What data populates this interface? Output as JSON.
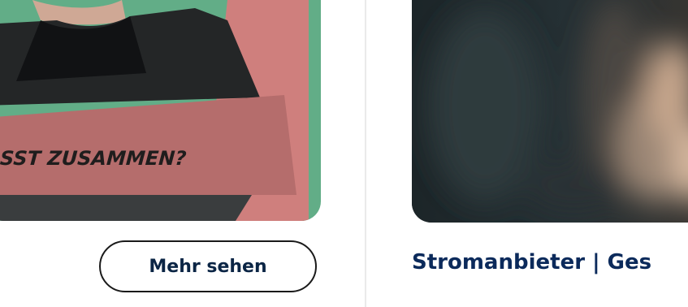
{
  "left_card": {
    "banner_text": "SST ZUSAMMEN?",
    "colors": {
      "background_green": "#62ad87",
      "banner_pink": "#cf7f7d",
      "banner_dark_pink": "#b26b6a",
      "jacket": "#222425",
      "skin": "#d9b8a3"
    }
  },
  "more_button": {
    "label": "Mehr sehen"
  },
  "right_card": {
    "title": "Stromanbieter | Ges",
    "title_color": "#0b2a5b"
  }
}
